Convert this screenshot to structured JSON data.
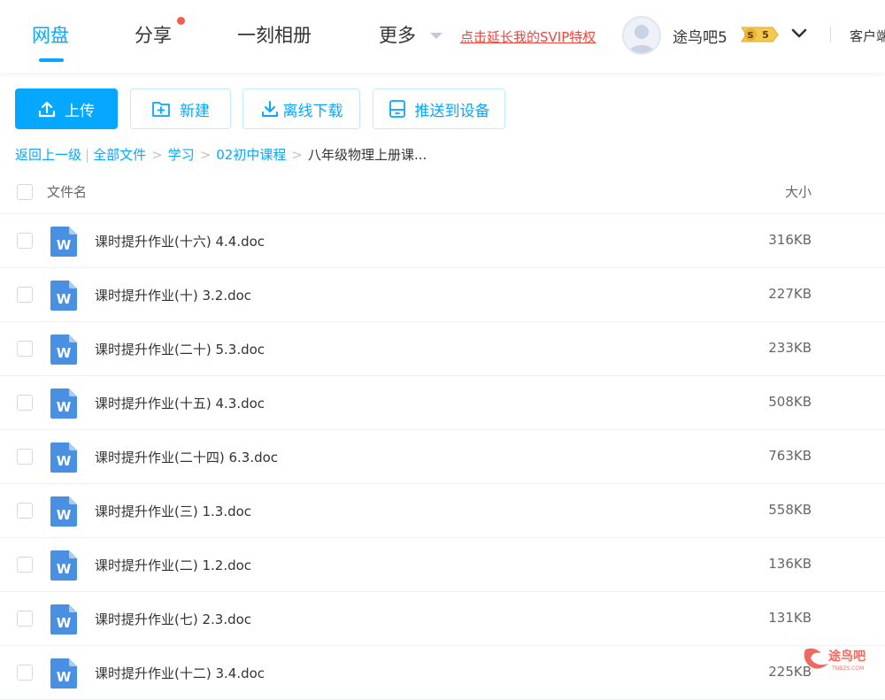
{
  "nav": {
    "tabs": [
      "网盘",
      "分享",
      "一刻相册",
      "更多"
    ],
    "svip_link": "点击延长我的SVIP特权",
    "username": "途鸟吧5",
    "vip_level": "5",
    "client": "客户端"
  },
  "toolbar": {
    "upload": "上传",
    "new": "新建",
    "offline": "离线下载",
    "push": "推送到设备"
  },
  "breadcrumb": {
    "back": "返回上一级",
    "all": "全部文件",
    "path": [
      "学习",
      "02初中课程"
    ],
    "current": "八年级物理上册课..."
  },
  "list": {
    "header_name": "文件名",
    "header_size": "大小",
    "files": [
      {
        "name": "课时提升作业(十六) 4.4.doc",
        "size": "316KB"
      },
      {
        "name": "课时提升作业(十) 3.2.doc",
        "size": "227KB"
      },
      {
        "name": "课时提升作业(二十) 5.3.doc",
        "size": "233KB"
      },
      {
        "name": "课时提升作业(十五) 4.3.doc",
        "size": "508KB"
      },
      {
        "name": "课时提升作业(二十四) 6.3.doc",
        "size": "763KB"
      },
      {
        "name": "课时提升作业(三) 1.3.doc",
        "size": "558KB"
      },
      {
        "name": "课时提升作业(二) 1.2.doc",
        "size": "136KB"
      },
      {
        "name": "课时提升作业(七) 2.3.doc",
        "size": "131KB"
      },
      {
        "name": "课时提升作业(十二) 3.4.doc",
        "size": "225KB"
      }
    ]
  },
  "colors": {
    "accent": "#06a7ff",
    "svip": "#f0453a",
    "doc_icon": "#4a90e2"
  },
  "icons": [
    "upload-icon",
    "folder-plus-icon",
    "download-icon",
    "device-icon",
    "word-doc-icon",
    "chevron-down-icon"
  ],
  "watermark": {
    "text": "途鸟吧",
    "sub": "TNBZS.COM"
  }
}
